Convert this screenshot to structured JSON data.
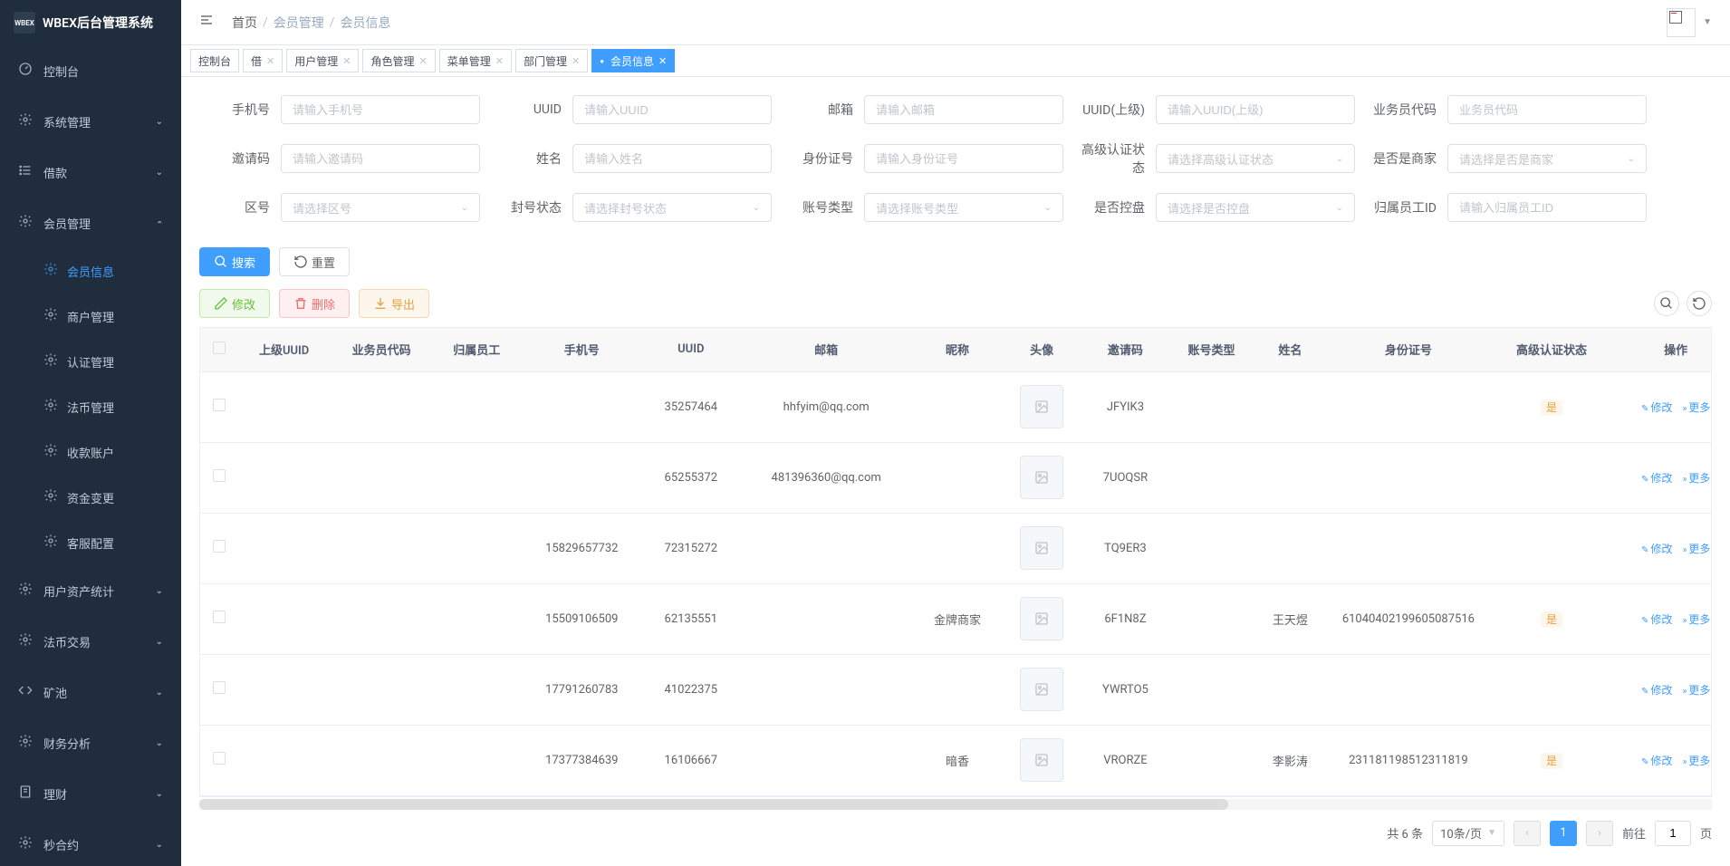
{
  "app": {
    "title": "WBEX后台管理系统",
    "logo_text": "WBEX"
  },
  "breadcrumb": {
    "home": "首页",
    "parent": "会员管理",
    "current": "会员信息"
  },
  "tabs": [
    {
      "label": "控制台",
      "closable": false
    },
    {
      "label": "借",
      "closable": true
    },
    {
      "label": "用户管理",
      "closable": true
    },
    {
      "label": "角色管理",
      "closable": true
    },
    {
      "label": "菜单管理",
      "closable": true
    },
    {
      "label": "部门管理",
      "closable": true
    },
    {
      "label": "会员信息",
      "closable": true,
      "active": true
    }
  ],
  "sidebar": {
    "items": [
      {
        "label": "控制台",
        "icon": "dashboard"
      },
      {
        "label": "系统管理",
        "icon": "gear",
        "expandable": true
      },
      {
        "label": "借款",
        "icon": "list",
        "expandable": true
      },
      {
        "label": "会员管理",
        "icon": "gear",
        "expandable": true,
        "expanded": true,
        "children": [
          {
            "label": "会员信息",
            "active": true
          },
          {
            "label": "商户管理"
          },
          {
            "label": "认证管理"
          },
          {
            "label": "法币管理"
          },
          {
            "label": "收款账户"
          },
          {
            "label": "资金变更"
          },
          {
            "label": "客服配置"
          }
        ]
      },
      {
        "label": "用户资产统计",
        "icon": "gear",
        "expandable": true
      },
      {
        "label": "法币交易",
        "icon": "gear",
        "expandable": true
      },
      {
        "label": "矿池",
        "icon": "code",
        "expandable": true
      },
      {
        "label": "财务分析",
        "icon": "gear",
        "expandable": true
      },
      {
        "label": "理财",
        "icon": "doc",
        "expandable": true
      },
      {
        "label": "秒合约",
        "icon": "gear",
        "expandable": true
      }
    ]
  },
  "search": {
    "fields": [
      {
        "label": "手机号",
        "placeholder": "请输入手机号",
        "type": "input"
      },
      {
        "label": "UUID",
        "placeholder": "请输入UUID",
        "type": "input"
      },
      {
        "label": "邮箱",
        "placeholder": "请输入邮箱",
        "type": "input"
      },
      {
        "label": "UUID(上级)",
        "placeholder": "请输入UUID(上级)",
        "type": "input"
      },
      {
        "label": "业务员代码",
        "placeholder": "业务员代码",
        "type": "input"
      },
      {
        "label": "邀请码",
        "placeholder": "请输入邀请码",
        "type": "input"
      },
      {
        "label": "姓名",
        "placeholder": "请输入姓名",
        "type": "input"
      },
      {
        "label": "身份证号",
        "placeholder": "请输入身份证号",
        "type": "input"
      },
      {
        "label": "高级认证状态",
        "placeholder": "请选择高级认证状态",
        "type": "select"
      },
      {
        "label": "是否是商家",
        "placeholder": "请选择是否是商家",
        "type": "select"
      },
      {
        "label": "区号",
        "placeholder": "请选择区号",
        "type": "select"
      },
      {
        "label": "封号状态",
        "placeholder": "请选择封号状态",
        "type": "select"
      },
      {
        "label": "账号类型",
        "placeholder": "请选择账号类型",
        "type": "select"
      },
      {
        "label": "是否控盘",
        "placeholder": "请选择是否控盘",
        "type": "select"
      },
      {
        "label": "归属员工ID",
        "placeholder": "请输入归属员工ID",
        "type": "input"
      }
    ]
  },
  "buttons": {
    "search": "搜索",
    "reset": "重置",
    "edit": "修改",
    "delete": "删除",
    "export": "导出",
    "more": "更多"
  },
  "table": {
    "headers": [
      "",
      "上级UUID",
      "业务员代码",
      "归属员工",
      "手机号",
      "UUID",
      "邮箱",
      "昵称",
      "头像",
      "邀请码",
      "账号类型",
      "姓名",
      "身份证号",
      "高级认证状态",
      "操作"
    ],
    "rows": [
      {
        "parent_uuid": "",
        "agent_code": "",
        "employee": "",
        "phone": "",
        "uuid": "35257464",
        "email": "hhfyim@qq.com",
        "nickname": "",
        "invite": "JFYIK3",
        "acct_type": "",
        "name": "",
        "idcard": "",
        "auth": "是"
      },
      {
        "parent_uuid": "",
        "agent_code": "",
        "employee": "",
        "phone": "",
        "uuid": "65255372",
        "email": "481396360@qq.com",
        "nickname": "",
        "invite": "7UOQSR",
        "acct_type": "",
        "name": "",
        "idcard": "",
        "auth": ""
      },
      {
        "parent_uuid": "",
        "agent_code": "",
        "employee": "",
        "phone": "15829657732",
        "uuid": "72315272",
        "email": "",
        "nickname": "",
        "invite": "TQ9ER3",
        "acct_type": "",
        "name": "",
        "idcard": "",
        "auth": ""
      },
      {
        "parent_uuid": "",
        "agent_code": "",
        "employee": "",
        "phone": "15509106509",
        "uuid": "62135551",
        "email": "",
        "nickname": "金牌商家",
        "invite": "6F1N8Z",
        "acct_type": "",
        "name": "王天煜",
        "idcard": "610404021996050875​16",
        "auth": "是"
      },
      {
        "parent_uuid": "",
        "agent_code": "",
        "employee": "",
        "phone": "17791260783",
        "uuid": "41022375",
        "email": "",
        "nickname": "",
        "invite": "YWRTO5",
        "acct_type": "",
        "name": "",
        "idcard": "",
        "auth": ""
      },
      {
        "parent_uuid": "",
        "agent_code": "",
        "employee": "",
        "phone": "17377384639",
        "uuid": "16106667",
        "email": "",
        "nickname": "暗香",
        "invite": "VRORZE",
        "acct_type": "",
        "name": "李影涛",
        "idcard": "231181198512311819",
        "auth": "是"
      }
    ]
  },
  "pagination": {
    "total_text": "共 6 条",
    "page_size": "10条/页",
    "current": "1",
    "goto": "前往",
    "page_suffix": "页",
    "goto_value": "1"
  }
}
